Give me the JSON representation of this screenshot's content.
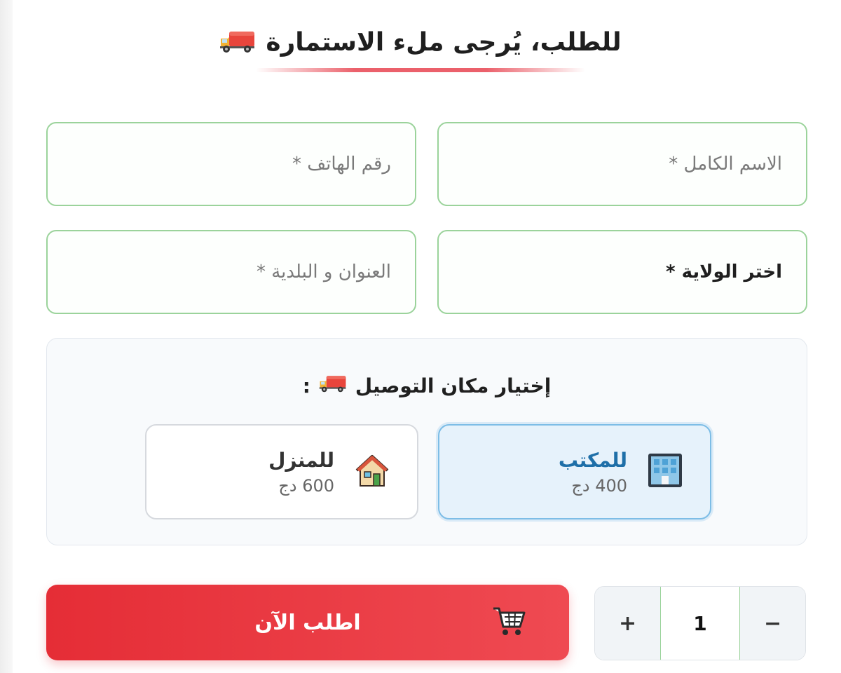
{
  "form": {
    "title": "للطلب، يُرجى ملء الاستمارة",
    "fields": {
      "full_name_placeholder": "الاسم الكامل *",
      "phone_placeholder": "رقم الهاتف *",
      "wilaya_label": "اختر الولاية *",
      "address_placeholder": "العنوان و البلدية *"
    }
  },
  "delivery": {
    "title": "إختيار مكان التوصيل",
    "title_suffix": ":",
    "options": [
      {
        "label": "للمكتب",
        "price": "400 دج",
        "icon": "office-building-icon",
        "selected": true
      },
      {
        "label": "للمنزل",
        "price": "600 دج",
        "icon": "house-icon",
        "selected": false
      }
    ]
  },
  "quantity": {
    "value": "1",
    "minus": "−",
    "plus": "+"
  },
  "order_button": {
    "label": "اطلب الآن",
    "icon": "cart-icon"
  },
  "colors": {
    "accent_red": "#e63946",
    "field_border": "#9bd39b",
    "selected_border": "#7dbde6",
    "selected_text": "#1e6fa8"
  }
}
